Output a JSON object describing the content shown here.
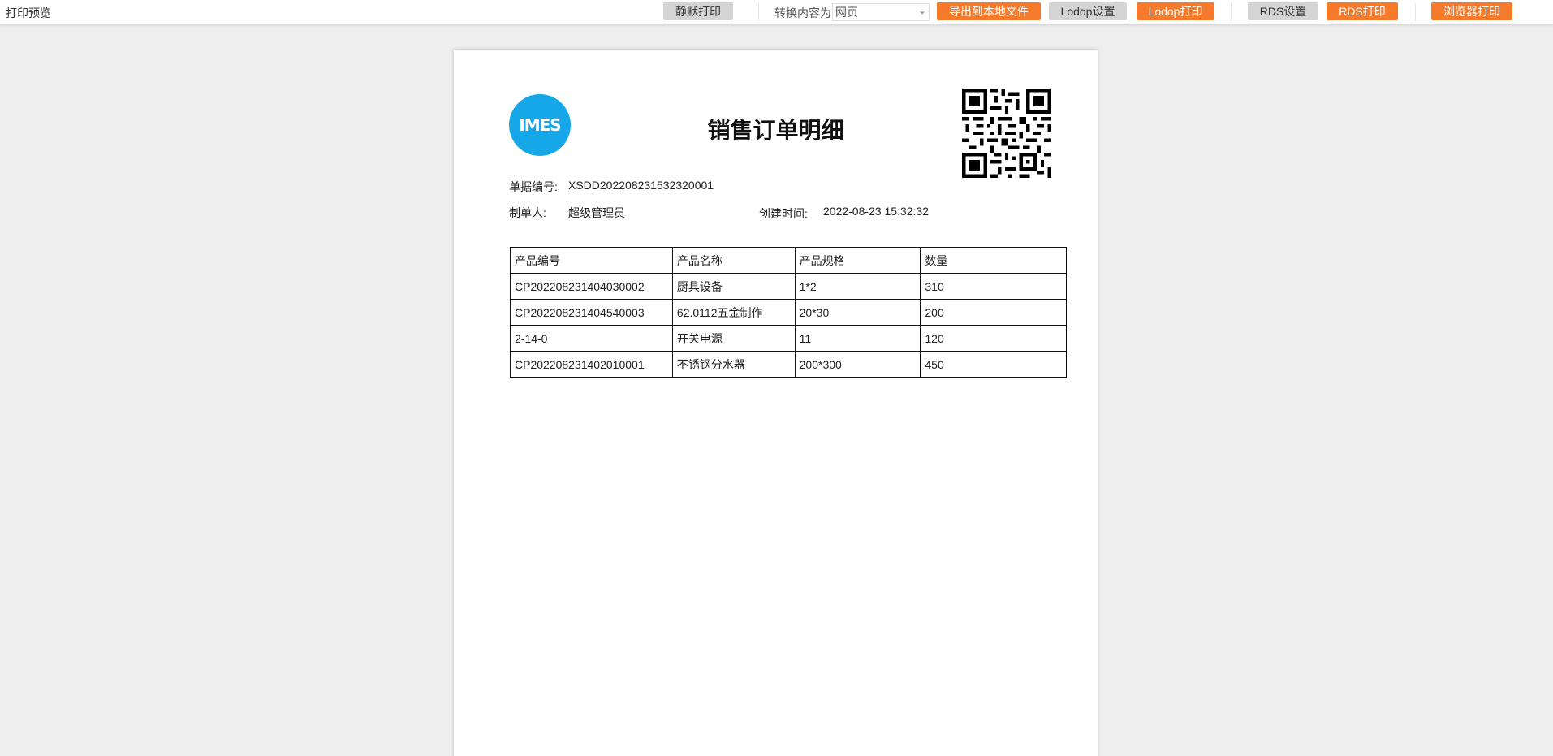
{
  "toolbar": {
    "title": "打印预览",
    "silent_print": "静默打印",
    "convert_label": "转换内容为",
    "convert_value": "网页",
    "export_local": "导出到本地文件",
    "lodop_settings": "Lodop设置",
    "lodop_print": "Lodop打印",
    "rds_settings": "RDS设置",
    "rds_print": "RDS打印",
    "browser_print": "浏览器打印"
  },
  "colors": {
    "accent_orange": "#f57a2c",
    "logo_blue": "#16a7e8"
  },
  "document": {
    "logo_text": "IMES",
    "title": "销售订单明细",
    "order_no_label": "单据编号:",
    "order_no": "XSDD202208231532320001",
    "creator_label": "制单人:",
    "creator": "超级管理员",
    "created_time_label": "创建时间:",
    "created_time": "2022-08-23 15:32:32",
    "table": {
      "headers": [
        "产品编号",
        "产品名称",
        "产品规格",
        "数量"
      ],
      "rows": [
        [
          "CP202208231404030002",
          "厨具设备",
          "1*2",
          "310"
        ],
        [
          "CP202208231404540003",
          "62.0112五金制作",
          "20*30",
          "200"
        ],
        [
          "2-14-0",
          "开关电源",
          "11",
          "120"
        ],
        [
          "CP202208231402010001",
          "不锈钢分水器",
          "200*300",
          "450"
        ]
      ]
    }
  }
}
